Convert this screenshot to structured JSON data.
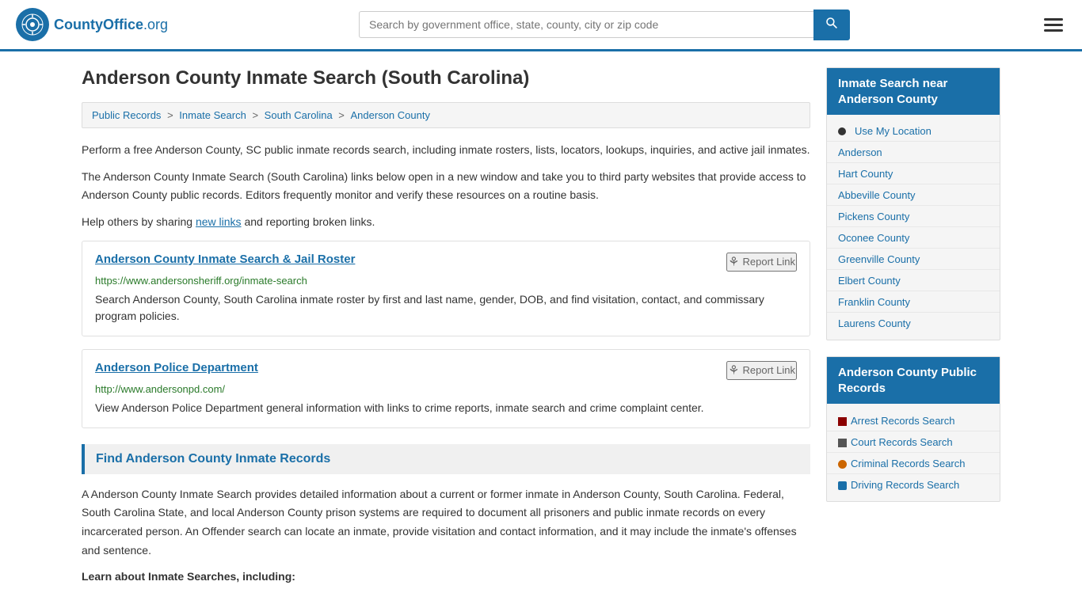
{
  "header": {
    "logo_text": "CountyOffice",
    "logo_org": ".org",
    "search_placeholder": "Search by government office, state, county, city or zip code"
  },
  "page": {
    "title": "Anderson County Inmate Search (South Carolina)",
    "breadcrumb": [
      {
        "label": "Public Records",
        "href": "#"
      },
      {
        "label": "Inmate Search",
        "href": "#"
      },
      {
        "label": "South Carolina",
        "href": "#"
      },
      {
        "label": "Anderson County",
        "href": "#"
      }
    ],
    "intro_1": "Perform a free Anderson County, SC public inmate records search, including inmate rosters, lists, locators, lookups, inquiries, and active jail inmates.",
    "intro_2": "The Anderson County Inmate Search (South Carolina) links below open in a new window and take you to third party websites that provide access to Anderson County public records. Editors frequently monitor and verify these resources on a routine basis.",
    "intro_3_pre": "Help others by sharing ",
    "intro_3_link": "new links",
    "intro_3_post": " and reporting broken links.",
    "resources": [
      {
        "title": "Anderson County Inmate Search & Jail Roster",
        "url": "https://www.andersonsheriff.org/inmate-search",
        "description": "Search Anderson County, South Carolina inmate roster by first and last name, gender, DOB, and find visitation, contact, and commissary program policies.",
        "report_label": "Report Link"
      },
      {
        "title": "Anderson Police Department",
        "url": "http://www.andersonpd.com/",
        "description": "View Anderson Police Department general information with links to crime reports, inmate search and crime complaint center.",
        "report_label": "Report Link"
      }
    ],
    "section_heading": "Find Anderson County Inmate Records",
    "section_body": "A Anderson County Inmate Search provides detailed information about a current or former inmate in Anderson County, South Carolina. Federal, South Carolina State, and local Anderson County prison systems are required to document all prisoners and public inmate records on every incarcerated person. An Offender search can locate an inmate, provide visitation and contact information, and it may include the inmate's offenses and sentence.",
    "section_subheading": "Learn about Inmate Searches, including:"
  },
  "sidebar": {
    "nearby_title": "Inmate Search near Anderson County",
    "nearby_links": [
      {
        "label": "Use My Location",
        "icon": "location"
      },
      {
        "label": "Anderson",
        "icon": "none"
      },
      {
        "label": "Hart County",
        "icon": "none"
      },
      {
        "label": "Abbeville County",
        "icon": "none"
      },
      {
        "label": "Pickens County",
        "icon": "none"
      },
      {
        "label": "Oconee County",
        "icon": "none"
      },
      {
        "label": "Greenville County",
        "icon": "none"
      },
      {
        "label": "Elbert County",
        "icon": "none"
      },
      {
        "label": "Franklin County",
        "icon": "none"
      },
      {
        "label": "Laurens County",
        "icon": "none"
      }
    ],
    "public_records_title": "Anderson County Public Records",
    "public_records_links": [
      {
        "label": "Arrest Records Search",
        "icon": "square"
      },
      {
        "label": "Court Records Search",
        "icon": "building"
      },
      {
        "label": "Criminal Records Search",
        "icon": "exclaim"
      },
      {
        "label": "Driving Records Search",
        "icon": "car"
      }
    ]
  }
}
